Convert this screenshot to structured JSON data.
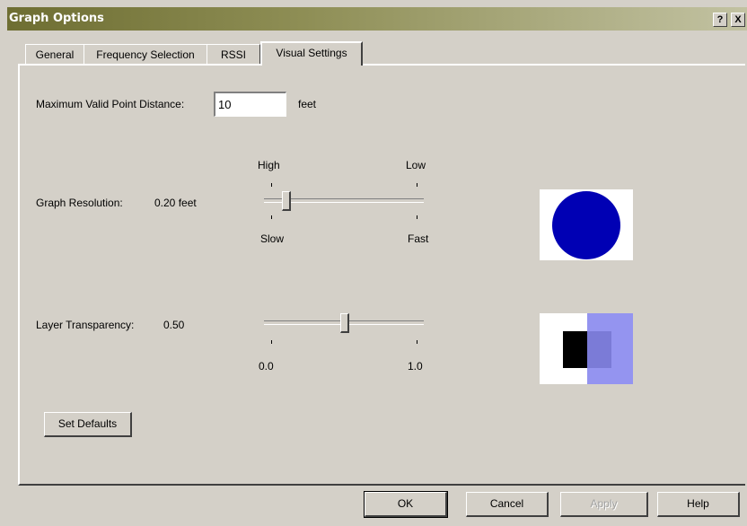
{
  "window": {
    "title": "Graph Options",
    "help_glyph": "?",
    "close_glyph": "X"
  },
  "tabs": [
    {
      "label": "General"
    },
    {
      "label": "Frequency Selection"
    },
    {
      "label": "RSSI"
    },
    {
      "label": "Visual Settings",
      "active": true
    }
  ],
  "max_distance": {
    "label": "Maximum Valid Point Distance:",
    "value": "10",
    "unit": "feet"
  },
  "graph_resolution": {
    "label": "Graph Resolution:",
    "value_text": "0.20 feet",
    "top_left": "High",
    "top_right": "Low",
    "bottom_left": "Slow",
    "bottom_right": "Fast",
    "slider_fraction": 0.1
  },
  "layer_transparency": {
    "label": "Layer Transparency:",
    "value_text": "0.50",
    "min_label": "0.0",
    "max_label": "1.0",
    "slider_fraction": 0.5
  },
  "colors": {
    "resolution_circle": "#0000b4",
    "overlay_square": "#8888ee",
    "base_square": "#000000"
  },
  "set_defaults_label": "Set Defaults",
  "footer": {
    "ok": "OK",
    "cancel": "Cancel",
    "apply": "Apply",
    "help": "Help"
  }
}
